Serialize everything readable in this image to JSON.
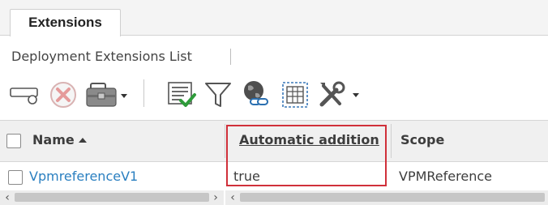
{
  "tabs": [
    {
      "label": "Extensions",
      "active": true
    }
  ],
  "panel": {
    "title": "Deployment Extensions List"
  },
  "toolbar": {
    "buttons": [
      {
        "icon": "create-extension-icon"
      },
      {
        "icon": "delete-icon",
        "disabled": true
      },
      {
        "icon": "toolbox-icon",
        "has_dropdown": true
      },
      {
        "icon": "list-check-icon"
      },
      {
        "icon": "filter-icon"
      },
      {
        "icon": "globe-link-icon"
      },
      {
        "icon": "table-select-icon"
      },
      {
        "icon": "tools-icon",
        "has_dropdown": true
      }
    ]
  },
  "grid": {
    "columns": [
      "Name",
      "Automatic addition",
      "Scope"
    ],
    "sort": {
      "column": "Name",
      "direction": "ascending"
    },
    "rows": [
      {
        "name": "VpmreferenceV1",
        "automatic_addition": "true",
        "scope": "VPMReference"
      }
    ]
  },
  "colors": {
    "link": "#2a7fc0",
    "highlight": "#d0303a",
    "header_bg": "#f0f0f0"
  }
}
